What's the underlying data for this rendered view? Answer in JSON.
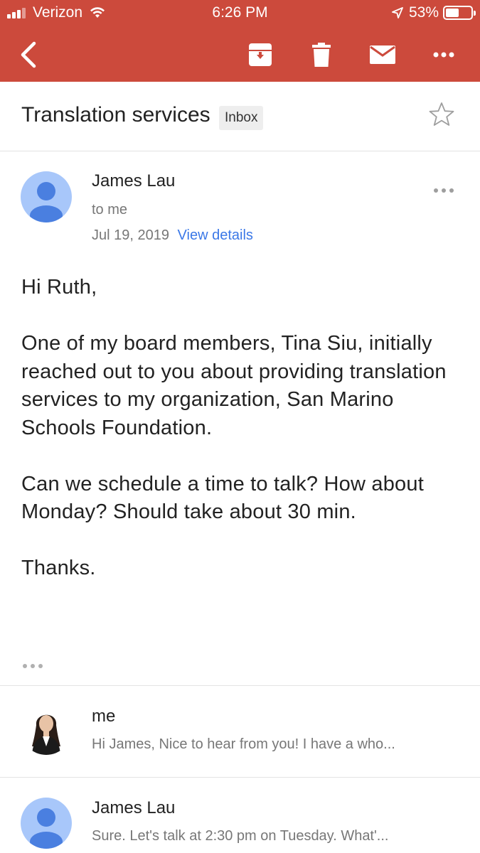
{
  "status_bar": {
    "carrier": "Verizon",
    "time": "6:26 PM",
    "battery": "53%"
  },
  "toolbar": {
    "icons": [
      "back-arrow-icon",
      "archive-icon",
      "trash-icon",
      "mail-icon",
      "more-icon"
    ]
  },
  "subject": {
    "title": "Translation services",
    "label": "Inbox"
  },
  "message": {
    "sender": "James Lau",
    "recipient": "to me",
    "date": "Jul 19, 2019",
    "details_link": "View details",
    "greeting": "Hi Ruth,",
    "paragraph1": "One of my board members, Tina Siu, initially reached out to you about providing translation services to my organization, San Marino Schools Foundation.",
    "paragraph2": "Can we schedule a time to talk? How about Monday? Should take about 30 min.",
    "closing": "Thanks."
  },
  "thread": [
    {
      "sender": "me",
      "snippet": "Hi James, Nice to hear from you! I have a who..."
    },
    {
      "sender": "James Lau",
      "snippet": "Sure. Let's talk at 2:30 pm on Tuesday. What'..."
    }
  ],
  "colors": {
    "header": "#cc4a3c",
    "avatar": "#a8c7fa",
    "avatar_figure": "#4a7fe0",
    "link": "#3b78e7"
  }
}
